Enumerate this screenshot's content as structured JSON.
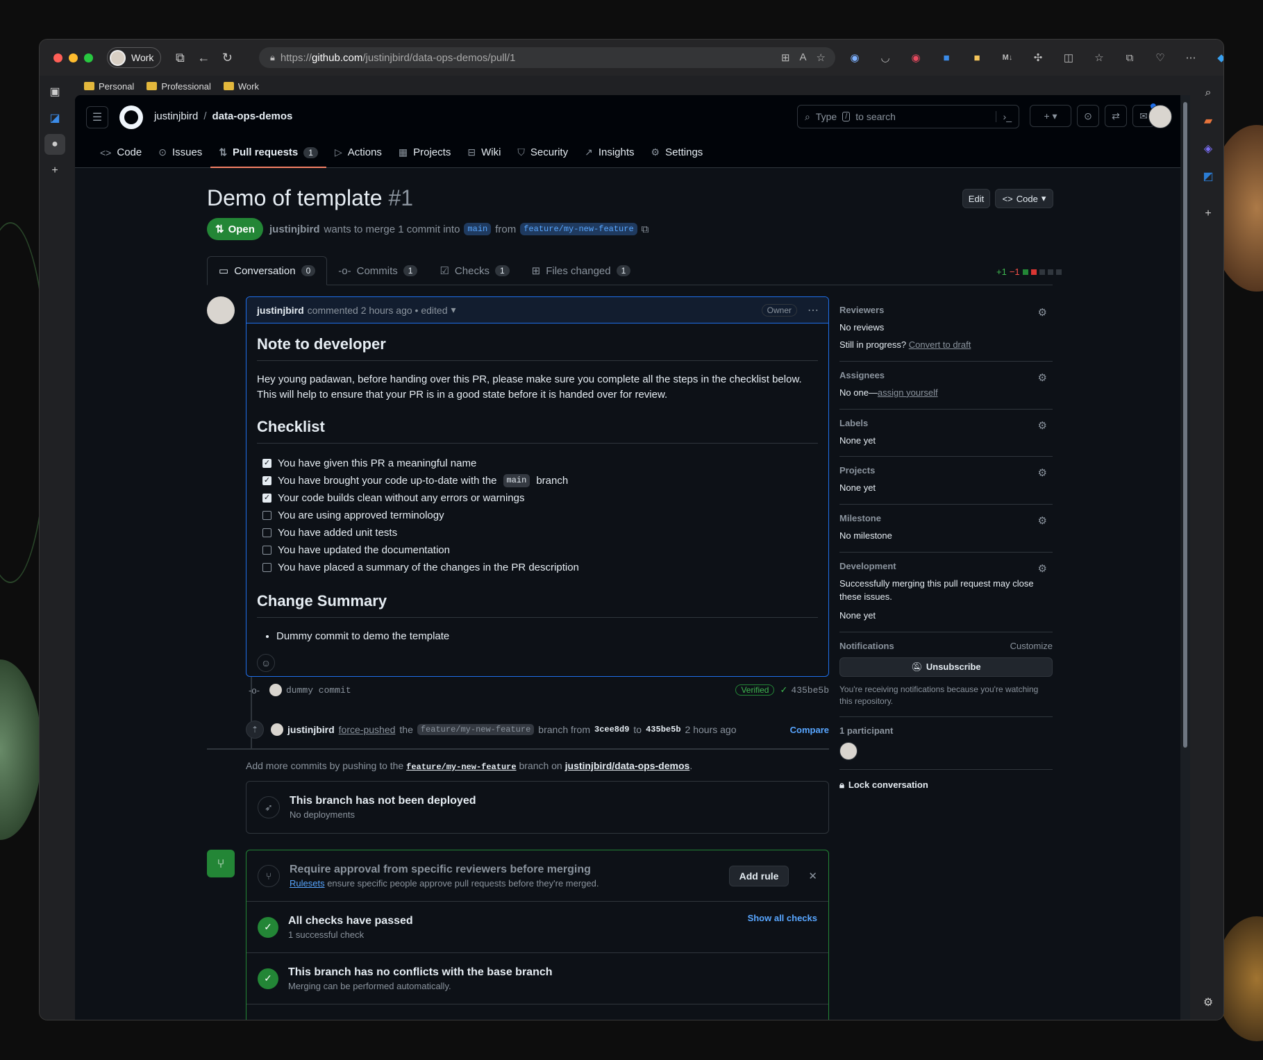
{
  "browser": {
    "profile_label": "Work",
    "url_prefix": "https://",
    "url_host": "github.com",
    "url_path": "/justinjbird/data-ops-demos/pull/1",
    "bookmarks": [
      "Personal",
      "Professional",
      "Work"
    ]
  },
  "github": {
    "owner": "justinjbird",
    "repo": "data-ops-demos",
    "search_placeholder_a": "Type",
    "search_slash": "/",
    "search_placeholder_b": "to search",
    "tabs": [
      {
        "label": "Code",
        "icon": "code-icon"
      },
      {
        "label": "Issues",
        "icon": "issue-icon"
      },
      {
        "label": "Pull requests",
        "icon": "pr-icon",
        "count": "1"
      },
      {
        "label": "Actions",
        "icon": "play-icon"
      },
      {
        "label": "Projects",
        "icon": "table-icon"
      },
      {
        "label": "Wiki",
        "icon": "book-icon"
      },
      {
        "label": "Security",
        "icon": "shield-icon"
      },
      {
        "label": "Insights",
        "icon": "graph-icon"
      },
      {
        "label": "Settings",
        "icon": "gear-icon"
      }
    ]
  },
  "pr": {
    "title": "Demo of template",
    "number": "#1",
    "edit_label": "Edit",
    "code_label": "Code",
    "state": "Open",
    "author": "justinjbird",
    "meta_text": "wants to merge 1 commit into",
    "base": "main",
    "from": "from",
    "head": "feature/my-new-feature",
    "tabs": [
      {
        "label": "Conversation",
        "count": "0"
      },
      {
        "label": "Commits",
        "count": "1"
      },
      {
        "label": "Checks",
        "count": "1"
      },
      {
        "label": "Files changed",
        "count": "1"
      }
    ],
    "additions": "+1",
    "deletions": "−1"
  },
  "comment": {
    "author": "justinjbird",
    "meta": "commented 2 hours ago • edited",
    "badge": "Owner",
    "h_note": "Note to developer",
    "intro": "Hey young padawan, before handing over this PR, please make sure you complete all the steps in the checklist below. This will help to ensure that your PR is in a good state before it is handed over for review.",
    "h_checklist": "Checklist",
    "checklist": [
      {
        "text": "You have given this PR a meaningful name",
        "checked": true
      },
      {
        "text_a": "You have brought your code up-to-date with the",
        "code": "main",
        "text_b": "branch",
        "checked": true
      },
      {
        "text": "Your code builds clean without any errors or warnings",
        "checked": true
      },
      {
        "text": "You are using approved terminology",
        "checked": false
      },
      {
        "text": "You have added unit tests",
        "checked": false
      },
      {
        "text": "You have updated the documentation",
        "checked": false
      },
      {
        "text": "You have placed a summary of the changes in the PR description",
        "checked": false
      }
    ],
    "h_summary": "Change Summary",
    "summary_items": [
      "Dummy commit to demo the template"
    ]
  },
  "timeline": {
    "commit_message": "dummy commit",
    "verified": "Verified",
    "commit_sha": "435be5b",
    "push_author": "justinjbird",
    "push_action": "force-pushed",
    "push_the": "the",
    "push_branch": "feature/my-new-feature",
    "push_branch_from": "branch from",
    "push_from_sha": "3cee8d9",
    "push_to": "to",
    "push_to_sha": "435be5b",
    "push_time": "2 hours ago",
    "compare": "Compare",
    "addmore_a": "Add more commits by pushing to the",
    "addmore_branch": "feature/my-new-feature",
    "addmore_b": "branch on",
    "addmore_repo": "justinjbird/data-ops-demos",
    "addmore_c": "."
  },
  "deploy": {
    "title": "This branch has not been deployed",
    "subtitle": "No deployments"
  },
  "merge": {
    "rule_title": "Require approval from specific reviewers before merging",
    "rule_link": "Rulesets",
    "rule_text": "ensure specific people approve pull requests before they're merged.",
    "add_rule": "Add rule",
    "checks_title": "All checks have passed",
    "checks_sub": "1 successful check",
    "show_checks": "Show all checks",
    "conflict_title": "This branch has no conflicts with the base branch",
    "conflict_sub": "Merging can be performed automatically."
  },
  "sidebar": {
    "reviewers": {
      "title": "Reviewers",
      "value": "No reviews",
      "progress": "Still in progress?",
      "draft_link": "Convert to draft"
    },
    "assignees": {
      "title": "Assignees",
      "value": "No one—",
      "link": "assign yourself"
    },
    "labels": {
      "title": "Labels",
      "value": "None yet"
    },
    "projects": {
      "title": "Projects",
      "value": "None yet"
    },
    "milestone": {
      "title": "Milestone",
      "value": "No milestone"
    },
    "development": {
      "title": "Development",
      "text": "Successfully merging this pull request may close these issues.",
      "value": "None yet"
    },
    "notifications": {
      "title": "Notifications",
      "customize": "Customize",
      "button": "Unsubscribe",
      "text": "You're receiving notifications because you're watching this repository."
    },
    "participants": {
      "title": "1 participant"
    },
    "lock": "Lock conversation"
  },
  "colors": {
    "page_bg": "#0d1117",
    "accent": "#1f6feb",
    "open_green": "#238636",
    "link": "#58a6ff"
  }
}
